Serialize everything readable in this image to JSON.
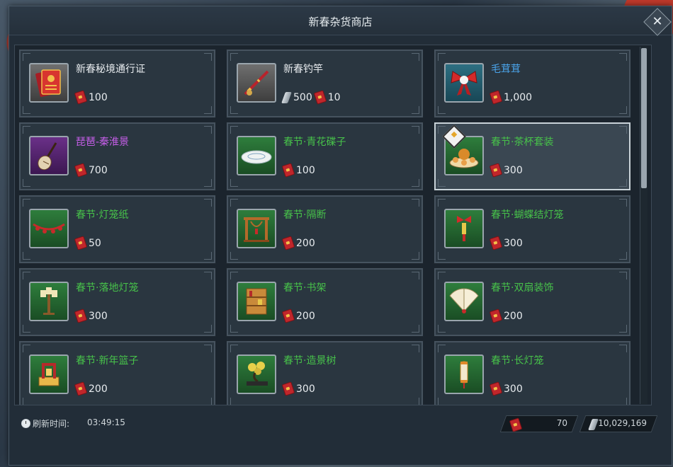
{
  "window": {
    "title": "新春杂货商店"
  },
  "items": [
    {
      "name": "新春秘境通行证",
      "rarity": "white",
      "icon": "red-pass-card-icon",
      "icon_bg": "grey",
      "price_currency": "red-ticket",
      "price": "100"
    },
    {
      "name": "新春钓竿",
      "rarity": "white",
      "icon": "fishing-rod-icon",
      "icon_bg": "grey",
      "price_currency": "crystal+red-ticket",
      "price_crystal": "500",
      "price": "10"
    },
    {
      "name": "毛茸茸",
      "rarity": "blue",
      "icon": "red-bow-icon",
      "icon_bg": "teal",
      "price_currency": "red-ticket",
      "price": "1,000"
    },
    {
      "name": "琵琶-秦淮景",
      "rarity": "purple",
      "icon": "pipa-lute-icon",
      "icon_bg": "purple",
      "price_currency": "red-ticket",
      "price": "700"
    },
    {
      "name": "春节·青花碟子",
      "rarity": "green",
      "icon": "porcelain-plate-icon",
      "icon_bg": "green",
      "price_currency": "red-ticket",
      "price": "100"
    },
    {
      "name": "春节·茶杯套装",
      "rarity": "green",
      "icon": "tea-set-icon",
      "icon_bg": "green",
      "price_currency": "red-ticket",
      "price": "300",
      "selected": true
    },
    {
      "name": "春节·灯笼纸",
      "rarity": "green",
      "icon": "lantern-garland-icon",
      "icon_bg": "green",
      "price_currency": "red-ticket",
      "price": "50"
    },
    {
      "name": "春节·隔断",
      "rarity": "green",
      "icon": "partition-icon",
      "icon_bg": "green",
      "price_currency": "red-ticket",
      "price": "200"
    },
    {
      "name": "春节·蝴蝶结灯笼",
      "rarity": "green",
      "icon": "bow-lantern-icon",
      "icon_bg": "green",
      "price_currency": "red-ticket",
      "price": "300"
    },
    {
      "name": "春节·落地灯笼",
      "rarity": "green",
      "icon": "floor-lantern-icon",
      "icon_bg": "green",
      "price_currency": "red-ticket",
      "price": "300"
    },
    {
      "name": "春节·书架",
      "rarity": "green",
      "icon": "bookshelf-icon",
      "icon_bg": "green",
      "price_currency": "red-ticket",
      "price": "200"
    },
    {
      "name": "春节·双扇装饰",
      "rarity": "green",
      "icon": "double-fan-icon",
      "icon_bg": "green",
      "price_currency": "red-ticket",
      "price": "200"
    },
    {
      "name": "春节·新年篮子",
      "rarity": "green",
      "icon": "new-year-basket-icon",
      "icon_bg": "green",
      "price_currency": "red-ticket",
      "price": "200"
    },
    {
      "name": "春节·造景树",
      "rarity": "green",
      "icon": "bonsai-tree-icon",
      "icon_bg": "green",
      "price_currency": "red-ticket",
      "price": "300"
    },
    {
      "name": "春节·长灯笼",
      "rarity": "green",
      "icon": "long-lantern-icon",
      "icon_bg": "green",
      "price_currency": "red-ticket",
      "price": "300"
    }
  ],
  "footer": {
    "refresh_label": "刷新时间:",
    "refresh_time": "03:49:15",
    "red_ticket_balance": "70",
    "crystal_balance": "10,029,169"
  },
  "colors": {
    "white": "#e8ecef",
    "blue": "#4aa3e8",
    "purple": "#c55ee8",
    "green": "#47c24a",
    "panel": "#222d38",
    "selected_border": "#c8d2d8"
  }
}
